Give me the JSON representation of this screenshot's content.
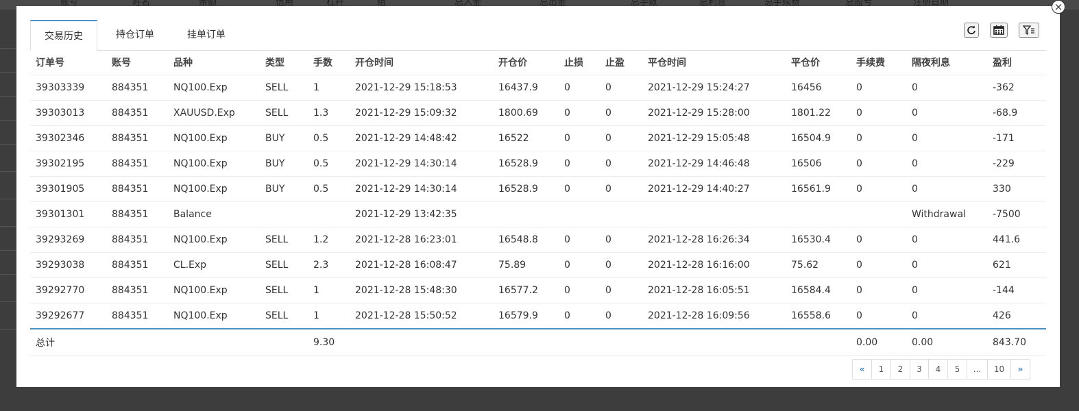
{
  "background_table": {
    "headers": [
      "账号",
      "姓名",
      "余额",
      "信用",
      "杠杆",
      "组",
      "总入金",
      "总出金",
      "总手数",
      "总利息",
      "总手续费",
      "总盈亏",
      "注册日期"
    ]
  },
  "modal": {
    "close_label": "×",
    "tabs": [
      {
        "label": "交易历史",
        "active": true
      },
      {
        "label": "持仓订单",
        "active": false
      },
      {
        "label": "挂单订单",
        "active": false
      }
    ],
    "toolbar": {
      "refresh_icon": "refresh-icon",
      "calendar_icon": "calendar-icon",
      "filter_icon": "filter-icon"
    },
    "table": {
      "columns": [
        "订单号",
        "账号",
        "品种",
        "类型",
        "手数",
        "开仓时间",
        "开仓价",
        "止损",
        "止盈",
        "平仓时间",
        "平仓价",
        "手续费",
        "隔夜利息",
        "盈利"
      ],
      "rows": [
        [
          "39303339",
          "884351",
          "NQ100.Exp",
          "SELL",
          "1",
          "2021-12-29 15:18:53",
          "16437.9",
          "0",
          "0",
          "2021-12-29 15:24:27",
          "16456",
          "0",
          "0",
          "-362"
        ],
        [
          "39303013",
          "884351",
          "XAUUSD.Exp",
          "SELL",
          "1.3",
          "2021-12-29 15:09:32",
          "1800.69",
          "0",
          "0",
          "2021-12-29 15:28:00",
          "1801.22",
          "0",
          "0",
          "-68.9"
        ],
        [
          "39302346",
          "884351",
          "NQ100.Exp",
          "BUY",
          "0.5",
          "2021-12-29 14:48:42",
          "16522",
          "0",
          "0",
          "2021-12-29 15:05:48",
          "16504.9",
          "0",
          "0",
          "-171"
        ],
        [
          "39302195",
          "884351",
          "NQ100.Exp",
          "BUY",
          "0.5",
          "2021-12-29 14:30:14",
          "16528.9",
          "0",
          "0",
          "2021-12-29 14:46:48",
          "16506",
          "0",
          "0",
          "-229"
        ],
        [
          "39301905",
          "884351",
          "NQ100.Exp",
          "BUY",
          "0.5",
          "2021-12-29 14:30:14",
          "16528.9",
          "0",
          "0",
          "2021-12-29 14:40:27",
          "16561.9",
          "0",
          "0",
          "330"
        ],
        [
          "39301301",
          "884351",
          "Balance",
          "",
          "",
          "2021-12-29 13:42:35",
          "",
          "",
          "",
          "",
          "",
          "",
          "Withdrawal",
          "-7500"
        ],
        [
          "39293269",
          "884351",
          "NQ100.Exp",
          "SELL",
          "1.2",
          "2021-12-28 16:23:01",
          "16548.8",
          "0",
          "0",
          "2021-12-28 16:26:34",
          "16530.4",
          "0",
          "0",
          "441.6"
        ],
        [
          "39293038",
          "884351",
          "CL.Exp",
          "SELL",
          "2.3",
          "2021-12-28 16:08:47",
          "75.89",
          "0",
          "0",
          "2021-12-28 16:16:00",
          "75.62",
          "0",
          "0",
          "621"
        ],
        [
          "39292770",
          "884351",
          "NQ100.Exp",
          "SELL",
          "1",
          "2021-12-28 15:48:30",
          "16577.2",
          "0",
          "0",
          "2021-12-28 16:05:51",
          "16584.4",
          "0",
          "0",
          "-144"
        ],
        [
          "39292677",
          "884351",
          "NQ100.Exp",
          "SELL",
          "1",
          "2021-12-28 15:50:52",
          "16579.9",
          "0",
          "0",
          "2021-12-28 16:09:56",
          "16558.6",
          "0",
          "0",
          "426"
        ]
      ],
      "total": [
        "总计",
        "",
        "",
        "",
        "9.30",
        "",
        "",
        "",
        "",
        "",
        "",
        "0.00",
        "0.00",
        "843.70"
      ]
    },
    "pagination": {
      "prev": "«",
      "pages": [
        "1",
        "2",
        "3",
        "4",
        "5",
        "...",
        "10"
      ],
      "next": "»"
    }
  },
  "colors": {
    "accent": "#4a90c0",
    "overlay": "#3d3d3d"
  }
}
